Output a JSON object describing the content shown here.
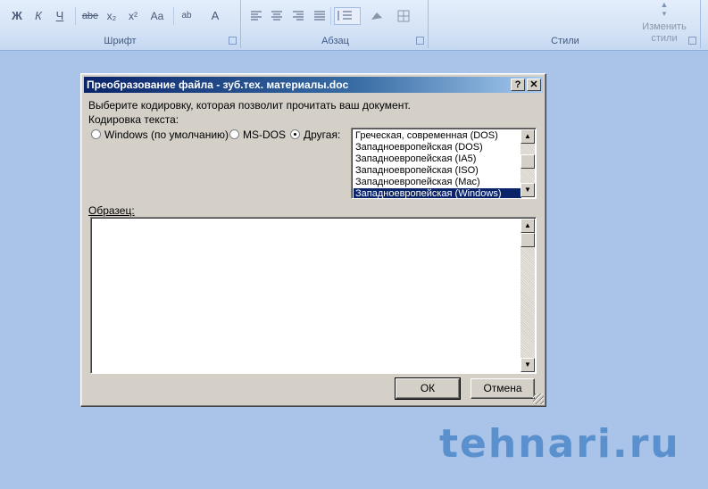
{
  "ribbon": {
    "font_group": {
      "label": "Шрифт",
      "buttons": [
        "Ж",
        "К",
        "Ч",
        "abe",
        "x₂",
        "x²",
        "Aa",
        "ab",
        "A"
      ]
    },
    "paragraph_group": {
      "label": "Абзац"
    },
    "styles_group": {
      "label": "Стили",
      "change_styles_label_1": "Изменить",
      "change_styles_label_2": "стили"
    }
  },
  "dialog": {
    "title": "Преобразование файла - зуб.тех. материалы.doc",
    "help_label": "?",
    "close_label": "✕",
    "prompt": "Выберите кодировку, которая позволит прочитать ваш документ.",
    "encoding_label": "Кодировка текста:",
    "radios": {
      "windows": "Windows (по умолчанию)",
      "msdos": "MS-DOS",
      "other": "Другая:"
    },
    "selected_radio": "other",
    "encodings": [
      "Греческая, современная (DOS)",
      "Западноевропейская (DOS)",
      "Западноевропейская (IA5)",
      "Западноевропейская (ISO)",
      "Западноевропейская (Mac)",
      "Западноевропейская (Windows)"
    ],
    "selected_encoding": "Западноевропейская (Windows)",
    "sample_label": "Образец:",
    "ok_label": "ОК",
    "cancel_label": "Отмена"
  },
  "watermark": "tehnari.ru"
}
